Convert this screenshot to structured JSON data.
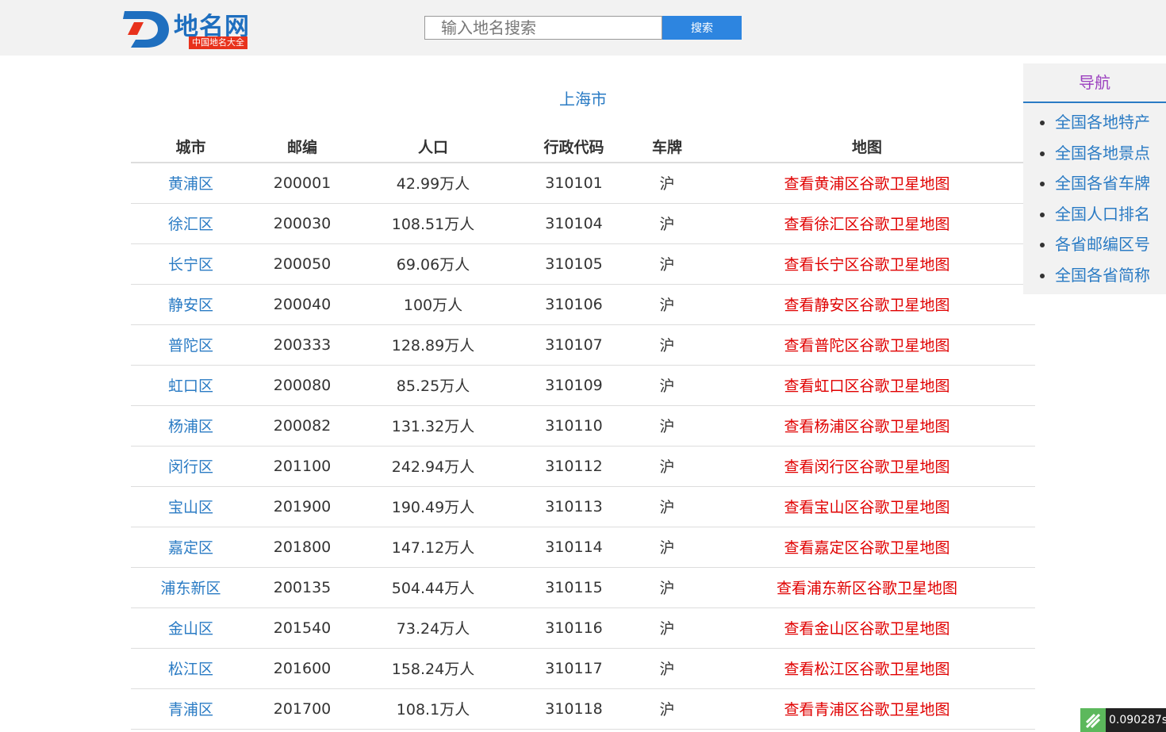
{
  "header": {
    "logo_text": "地名网",
    "logo_sub": "中国地名大全",
    "search_placeholder": "输入地名搜索",
    "search_button": "搜索"
  },
  "page_title": "上海市",
  "table": {
    "headers": [
      "城市",
      "邮编",
      "人口",
      "行政代码",
      "车牌",
      "地图"
    ],
    "rows": [
      {
        "city": "黄浦区",
        "postcode": "200001",
        "population": "42.99万人",
        "code": "310101",
        "plate": "沪",
        "map": "查看黄浦区谷歌卫星地图"
      },
      {
        "city": "徐汇区",
        "postcode": "200030",
        "population": "108.51万人",
        "code": "310104",
        "plate": "沪",
        "map": "查看徐汇区谷歌卫星地图"
      },
      {
        "city": "长宁区",
        "postcode": "200050",
        "population": "69.06万人",
        "code": "310105",
        "plate": "沪",
        "map": "查看长宁区谷歌卫星地图"
      },
      {
        "city": "静安区",
        "postcode": "200040",
        "population": "100万人",
        "code": "310106",
        "plate": "沪",
        "map": "查看静安区谷歌卫星地图"
      },
      {
        "city": "普陀区",
        "postcode": "200333",
        "population": "128.89万人",
        "code": "310107",
        "plate": "沪",
        "map": "查看普陀区谷歌卫星地图"
      },
      {
        "city": "虹口区",
        "postcode": "200080",
        "population": "85.25万人",
        "code": "310109",
        "plate": "沪",
        "map": "查看虹口区谷歌卫星地图"
      },
      {
        "city": "杨浦区",
        "postcode": "200082",
        "population": "131.32万人",
        "code": "310110",
        "plate": "沪",
        "map": "查看杨浦区谷歌卫星地图"
      },
      {
        "city": "闵行区",
        "postcode": "201100",
        "population": "242.94万人",
        "code": "310112",
        "plate": "沪",
        "map": "查看闵行区谷歌卫星地图"
      },
      {
        "city": "宝山区",
        "postcode": "201900",
        "population": "190.49万人",
        "code": "310113",
        "plate": "沪",
        "map": "查看宝山区谷歌卫星地图"
      },
      {
        "city": "嘉定区",
        "postcode": "201800",
        "population": "147.12万人",
        "code": "310114",
        "plate": "沪",
        "map": "查看嘉定区谷歌卫星地图"
      },
      {
        "city": "浦东新区",
        "postcode": "200135",
        "population": "504.44万人",
        "code": "310115",
        "plate": "沪",
        "map": "查看浦东新区谷歌卫星地图"
      },
      {
        "city": "金山区",
        "postcode": "201540",
        "population": "73.24万人",
        "code": "310116",
        "plate": "沪",
        "map": "查看金山区谷歌卫星地图"
      },
      {
        "city": "松江区",
        "postcode": "201600",
        "population": "158.24万人",
        "code": "310117",
        "plate": "沪",
        "map": "查看松江区谷歌卫星地图"
      },
      {
        "city": "青浦区",
        "postcode": "201700",
        "population": "108.1万人",
        "code": "310118",
        "plate": "沪",
        "map": "查看青浦区谷歌卫星地图"
      }
    ]
  },
  "nav": {
    "title": "导航",
    "items": [
      "全国各地特产",
      "全国各地景点",
      "全国各省车牌",
      "全国人口排名",
      "各省邮编区号",
      "全国各省简称"
    ]
  },
  "timer": "0.090287s",
  "colors": {
    "link": "#2a7bc4",
    "map_link": "#e00000",
    "nav_title": "#9b3fbf",
    "button": "#2d85e0"
  }
}
